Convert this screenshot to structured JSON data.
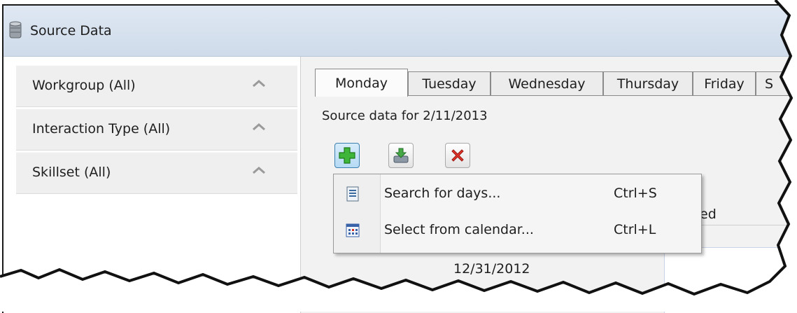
{
  "window": {
    "title": "Source Data"
  },
  "sidebar": {
    "items": [
      {
        "label": "Workgroup (All)"
      },
      {
        "label": "Interaction Type (All)"
      },
      {
        "label": "Skillset (All)"
      }
    ]
  },
  "tabs": [
    {
      "label": "Monday",
      "active": true
    },
    {
      "label": "Tuesday"
    },
    {
      "label": "Wednesday"
    },
    {
      "label": "Thursday"
    },
    {
      "label": "Friday"
    },
    {
      "label": "S"
    }
  ],
  "main": {
    "source_label": "Source data for 2/11/2013",
    "toolbar": {
      "add_icon": "add-icon",
      "import_icon": "import-icon",
      "delete_icon": "delete-icon"
    },
    "behind_text": "ed",
    "date_cell": "12/31/2012"
  },
  "menu": {
    "items": [
      {
        "label": "Search for days...",
        "shortcut": "Ctrl+S",
        "icon": "document-list-icon"
      },
      {
        "label": "Select from calendar...",
        "shortcut": "Ctrl+L",
        "icon": "calendar-icon"
      }
    ]
  }
}
